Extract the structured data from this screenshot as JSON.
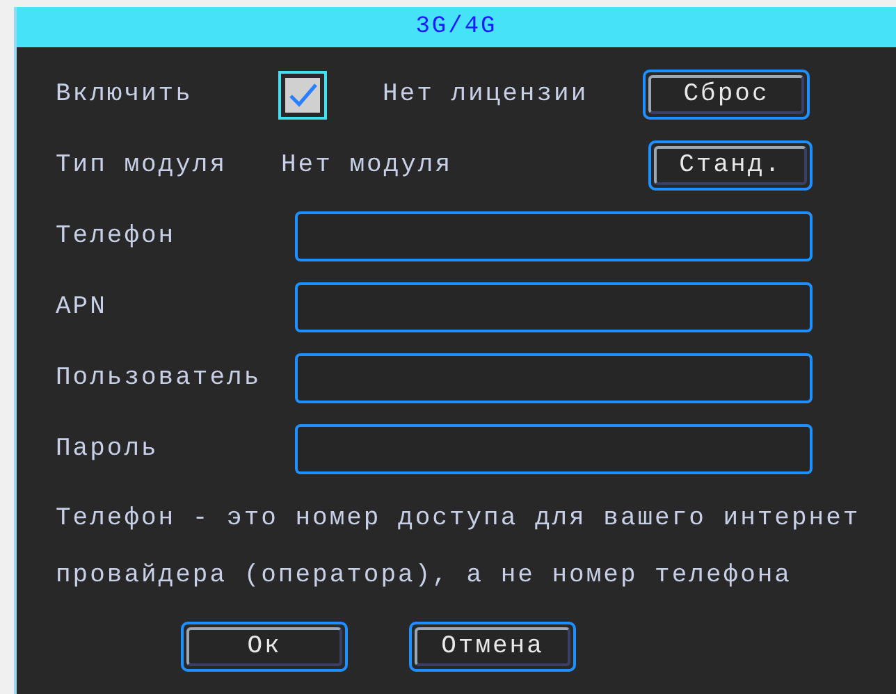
{
  "window": {
    "title": "3G/4G"
  },
  "enable": {
    "label": "Включить",
    "checked": true,
    "status": "Нет лицензии",
    "button": "Сброс"
  },
  "module": {
    "label": "Тип модуля",
    "value": "Нет модуля",
    "button": "Станд."
  },
  "fields": [
    {
      "label": "Телефон"
    },
    {
      "label": "APN"
    },
    {
      "label": "Пользователь"
    },
    {
      "label": "Пароль"
    }
  ],
  "hint": [
    "Телефон - это номер доступа для вашего интернет",
    "провайдера (оператора), а не номер телефона"
  ],
  "buttons": [
    "Ок",
    "Отмена"
  ]
}
